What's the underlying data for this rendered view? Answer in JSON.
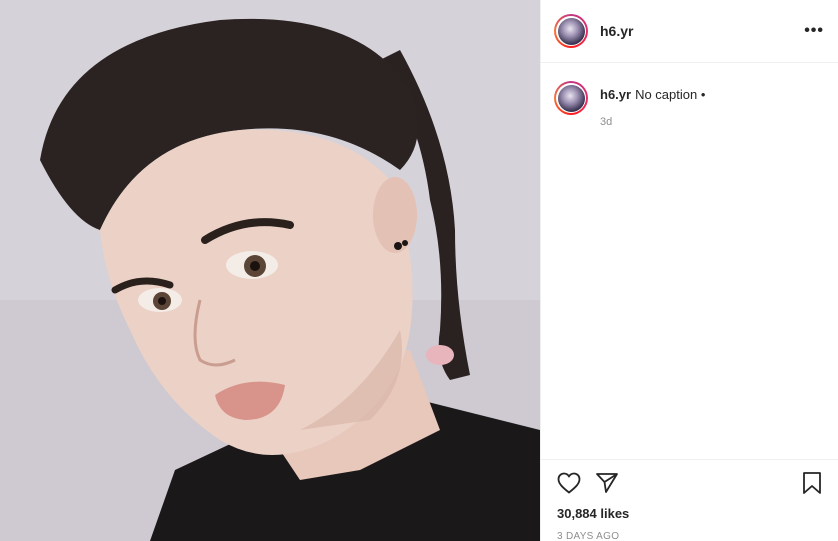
{
  "post": {
    "username": "h6.yr",
    "caption": "No caption",
    "caption_dot": "•",
    "comment_time": "3d",
    "likes": "30,884 likes",
    "posted_ago": "3 DAYS AGO"
  },
  "icons": {
    "more": "more-options-icon",
    "like": "heart-icon",
    "share": "paper-plane-icon",
    "save": "bookmark-icon"
  },
  "colors": {
    "text": "#262626",
    "muted": "#8e8e8e",
    "border": "#efefef"
  }
}
